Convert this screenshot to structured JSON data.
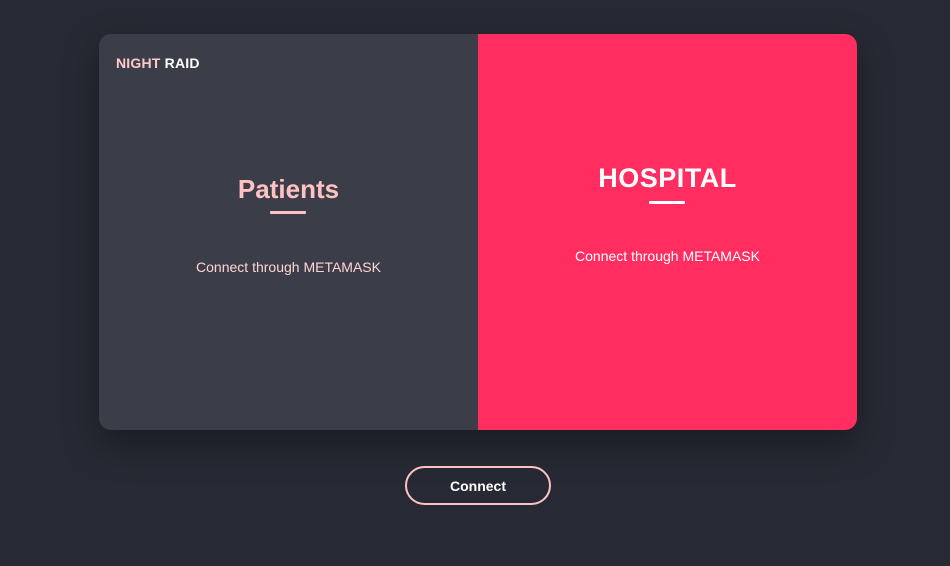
{
  "brand": {
    "part1": "NIGHT",
    "part2": "RAID"
  },
  "patients_panel": {
    "title": "Patients",
    "subtitle": "Connect through METAMASK"
  },
  "hospital_panel": {
    "title": "HOSPITAL",
    "subtitle": "Connect through METAMASK"
  },
  "connect_button": {
    "label": "Connect"
  },
  "colors": {
    "background": "#272a34",
    "left_panel": "#3b3e48",
    "right_panel": "#ff2d60",
    "accent_pink": "#ffc2c2",
    "text_white": "#ffffff"
  }
}
